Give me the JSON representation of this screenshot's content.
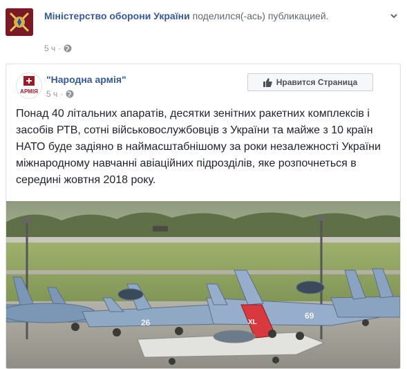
{
  "shared_header": {
    "page_name": "Міністерство оборони України",
    "action_text": " поделился(-ась) публикацией.",
    "time": "5 ч",
    "dot": "·"
  },
  "inner_post": {
    "page_name": "\"Народна армія\"",
    "time": "5 ч",
    "dot": "·",
    "like_page_label": "Нравится Страница",
    "body": "Понад 40 літальних апаратів, десятки зенітних ракетних комплексів і засобів РТВ, сотні військовослужбовців з України та майже з 10 країн НАТО буде задіяно в наймасштабнішому за роки незалежності України міжнародному навчанні авіаційних підрозділів, яке розпочнеться в середині жовтня 2018 року."
  },
  "photo": {
    "aircraft_numbers": [
      "26",
      "69"
    ],
    "tail_code": "XL"
  },
  "icons": {
    "globe": "globe-icon",
    "like": "thumbs-up-icon",
    "more": "chevron-down-icon"
  },
  "colors": {
    "link": "#365899",
    "meta": "#90949c",
    "emblem_bg": "#7a1a25"
  }
}
